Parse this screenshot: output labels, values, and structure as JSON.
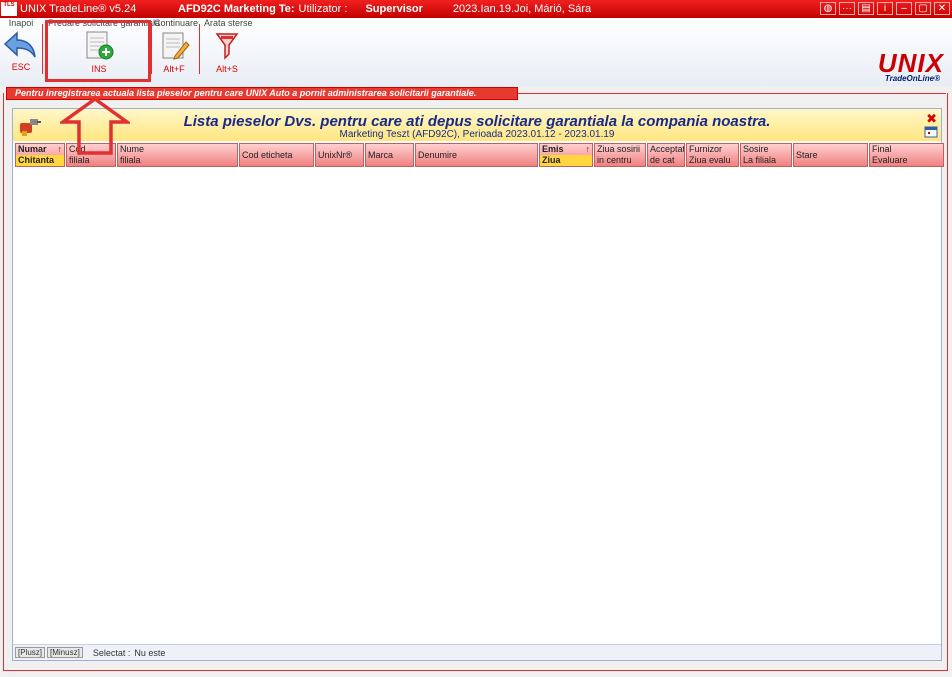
{
  "titlebar": {
    "app_icon": "TLS",
    "app": "UNIX TradeLine® v5.24",
    "company": "AFD92C Marketing Te:",
    "user_label": "Utilizator :",
    "user": "Supervisor",
    "datetime": "2023.Ian.19.Joi, Márió, Sára",
    "buttons": [
      "globe-icon",
      "dots-icon",
      "window-icon",
      "info-icon",
      "minimize-icon",
      "maximize-icon",
      "close-icon"
    ]
  },
  "toolbar": {
    "back": {
      "label": "Inapoi",
      "hotkey": "ESC",
      "icon": "back-arrow-icon"
    },
    "submit": {
      "label": "Predare solicitare garantiala",
      "hotkey": "INS",
      "icon": "new-document-icon"
    },
    "continue": {
      "label": "Continuare",
      "hotkey": "Alt+F",
      "icon": "edit-document-icon"
    },
    "deleted": {
      "label": "Arata sterse",
      "hotkey": "Alt+S",
      "icon": "filter-funnel-icon"
    }
  },
  "logo": {
    "word": "UNIX",
    "tagline": "TradeOnLine®"
  },
  "hint": "Pentru inregistrarea actuala lista pieselor pentru care UNIX Auto a pornit administrarea solicitarii garantiale.",
  "panel": {
    "title": "Lista pieselor Dvs. pentru care ati depus solicitare garantiala la compania noastra.",
    "subtitle": "Marketing Teszt (AFD92C), Perioada 2023.01.12 - 2023.01.19"
  },
  "columns": [
    {
      "r1": "Numar",
      "r2": "Chitanta",
      "w": 50
    },
    {
      "r1": "Cod",
      "r2": "filiala",
      "w": 50
    },
    {
      "r1": "Nume",
      "r2": "filiala",
      "w": 121
    },
    {
      "r1": "Cod eticheta",
      "r2": "",
      "w": 75
    },
    {
      "r1": "UnixNr®",
      "r2": "",
      "w": 49
    },
    {
      "r1": "Marca",
      "r2": "",
      "w": 49
    },
    {
      "r1": "Denumire",
      "r2": "",
      "w": 123
    },
    {
      "r1": "Emis",
      "r2": "Ziua",
      "w": 54
    },
    {
      "r1": "Ziua sosirii",
      "r2": "in centru",
      "w": 52
    },
    {
      "r1": "Acceptat",
      "r2": "de cat",
      "w": 38
    },
    {
      "r1": "Furnizor",
      "r2": "Ziua evalu",
      "w": 53
    },
    {
      "r1": "Sosire",
      "r2": "La filiala",
      "w": 52
    },
    {
      "r1": "Stare",
      "r2": "",
      "w": 75
    },
    {
      "r1": "Final",
      "r2": "Evaluare",
      "w": 75
    }
  ],
  "footer": {
    "plus": "[Plusz]",
    "minus": "[Minusz]",
    "selected_label": "Selectat :",
    "selected_value": "Nu este"
  }
}
